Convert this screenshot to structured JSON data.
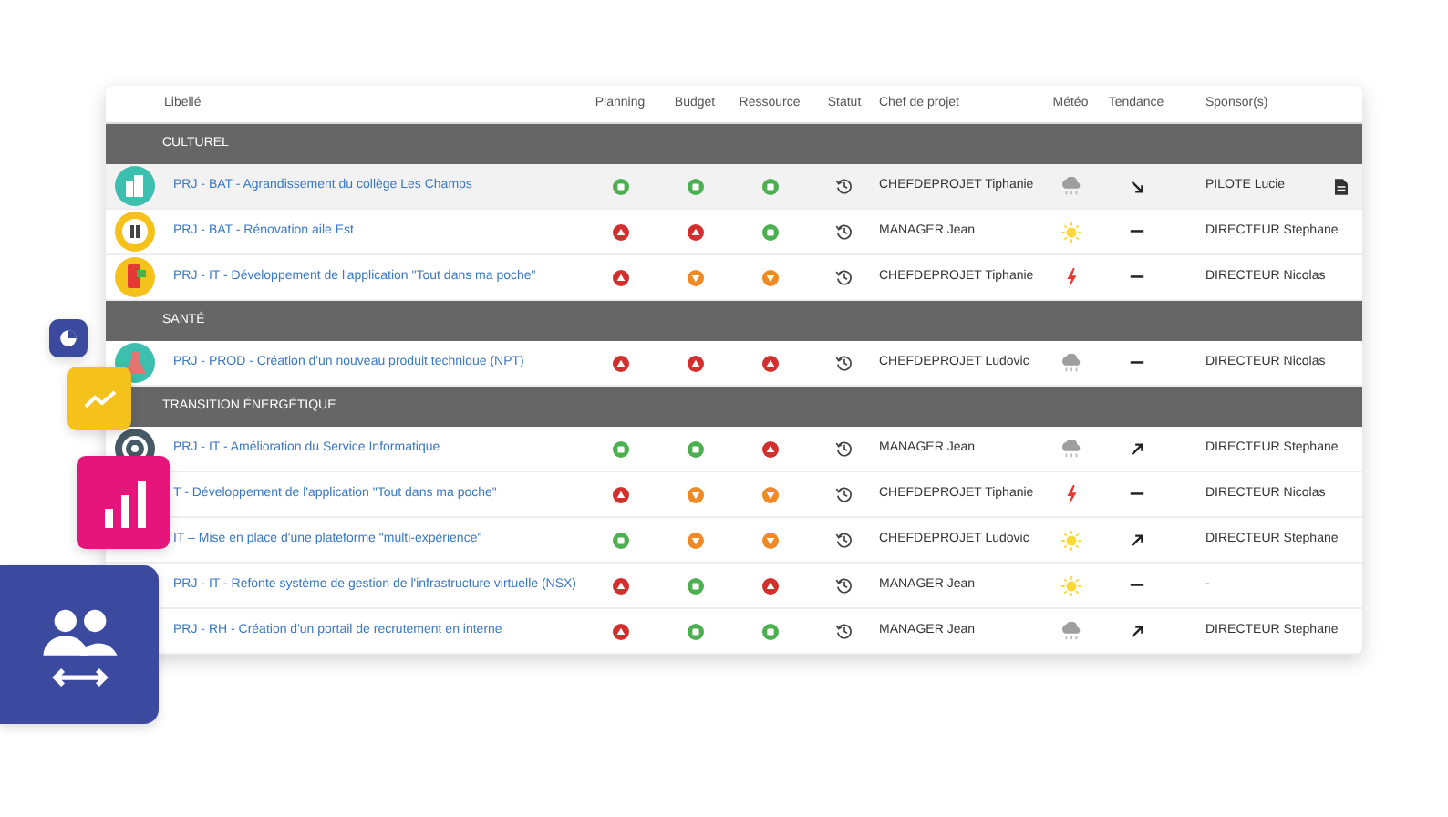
{
  "table": {
    "columns": [
      "Libellé",
      "Planning",
      "Budget",
      "Ressource",
      "Statut",
      "Chef de projet",
      "Météo",
      "Tendance",
      "Sponsor(s)"
    ],
    "groups": [
      {
        "name": "CULTUREL",
        "rows": [
          {
            "avatar": {
              "kind": "building"
            },
            "label": "PRJ - BAT - Agrandissement du collège Les Champs",
            "selected": true,
            "planning": {
              "kind": "ok"
            },
            "budget": {
              "kind": "ok"
            },
            "resource": {
              "kind": "ok"
            },
            "manager": "CHEFDEPROJET Tiphanie",
            "weather": {
              "kind": "cloud"
            },
            "trend": {
              "kind": "down"
            },
            "sponsor": "PILOTE Lucie",
            "attachment": true
          },
          {
            "avatar": {
              "kind": "pause"
            },
            "label": "PRJ - BAT - Rénovation aile Est",
            "selected": false,
            "planning": {
              "kind": "alert"
            },
            "budget": {
              "kind": "alert"
            },
            "resource": {
              "kind": "ok"
            },
            "manager": "MANAGER Jean",
            "weather": {
              "kind": "sun"
            },
            "trend": {
              "kind": "flat"
            },
            "sponsor": "DIRECTEUR Stephane",
            "attachment": false
          },
          {
            "avatar": {
              "kind": "phone"
            },
            "label": "PRJ - IT - Développement de l'application \"Tout dans ma poche\"",
            "selected": false,
            "planning": {
              "kind": "alert"
            },
            "budget": {
              "kind": "warning"
            },
            "resource": {
              "kind": "warning"
            },
            "manager": "CHEFDEPROJET Tiphanie",
            "weather": {
              "kind": "storm"
            },
            "trend": {
              "kind": "flat"
            },
            "sponsor": "DIRECTEUR Nicolas",
            "attachment": false
          }
        ]
      },
      {
        "name": "SANTÉ",
        "rows": [
          {
            "avatar": {
              "kind": "flask"
            },
            "label": "PRJ - PROD - Création d'un nouveau produit technique (NPT)",
            "selected": false,
            "planning": {
              "kind": "alert"
            },
            "budget": {
              "kind": "alert"
            },
            "resource": {
              "kind": "alert"
            },
            "manager": "CHEFDEPROJET Ludovic",
            "weather": {
              "kind": "cloud"
            },
            "trend": {
              "kind": "flat"
            },
            "sponsor": "DIRECTEUR Nicolas",
            "attachment": false
          }
        ]
      },
      {
        "name": "TRANSITION ÉNERGÉTIQUE",
        "rows": [
          {
            "avatar": {
              "kind": "gear"
            },
            "label": "PRJ - IT - Amélioration du Service Informatique",
            "selected": false,
            "planning": {
              "kind": "ok"
            },
            "budget": {
              "kind": "ok"
            },
            "resource": {
              "kind": "alert"
            },
            "manager": "MANAGER Jean",
            "weather": {
              "kind": "cloud"
            },
            "trend": {
              "kind": "up"
            },
            "sponsor": "DIRECTEUR Stephane",
            "attachment": false
          },
          {
            "label": "T - Développement de l'application \"Tout dans ma poche\"",
            "selected": false,
            "planning": {
              "kind": "alert"
            },
            "budget": {
              "kind": "warning"
            },
            "resource": {
              "kind": "warning"
            },
            "manager": "CHEFDEPROJET Tiphanie",
            "weather": {
              "kind": "storm"
            },
            "trend": {
              "kind": "flat"
            },
            "sponsor": "DIRECTEUR Nicolas",
            "attachment": false
          },
          {
            "label": "IT – Mise en place d'une plateforme \"multi-expérience\"",
            "selected": false,
            "planning": {
              "kind": "ok"
            },
            "budget": {
              "kind": "warning"
            },
            "resource": {
              "kind": "warning"
            },
            "manager": "CHEFDEPROJET Ludovic",
            "weather": {
              "kind": "sun"
            },
            "trend": {
              "kind": "up"
            },
            "sponsor": "DIRECTEUR Stephane",
            "attachment": false
          },
          {
            "label": "PRJ - IT - Refonte système de gestion de l'infrastructure virtuelle (NSX)",
            "selected": false,
            "planning": {
              "kind": "alert"
            },
            "budget": {
              "kind": "ok"
            },
            "resource": {
              "kind": "alert"
            },
            "manager": "MANAGER Jean",
            "weather": {
              "kind": "sun"
            },
            "trend": {
              "kind": "flat"
            },
            "sponsor": "-",
            "attachment": false
          },
          {
            "label": "PRJ - RH - Création d'un portail de recrutement en interne",
            "selected": false,
            "planning": {
              "kind": "alert"
            },
            "budget": {
              "kind": "ok"
            },
            "resource": {
              "kind": "ok"
            },
            "manager": "MANAGER Jean",
            "weather": {
              "kind": "cloud"
            },
            "trend": {
              "kind": "up"
            },
            "sponsor": "DIRECTEUR Stephane",
            "attachment": false
          }
        ]
      }
    ]
  }
}
